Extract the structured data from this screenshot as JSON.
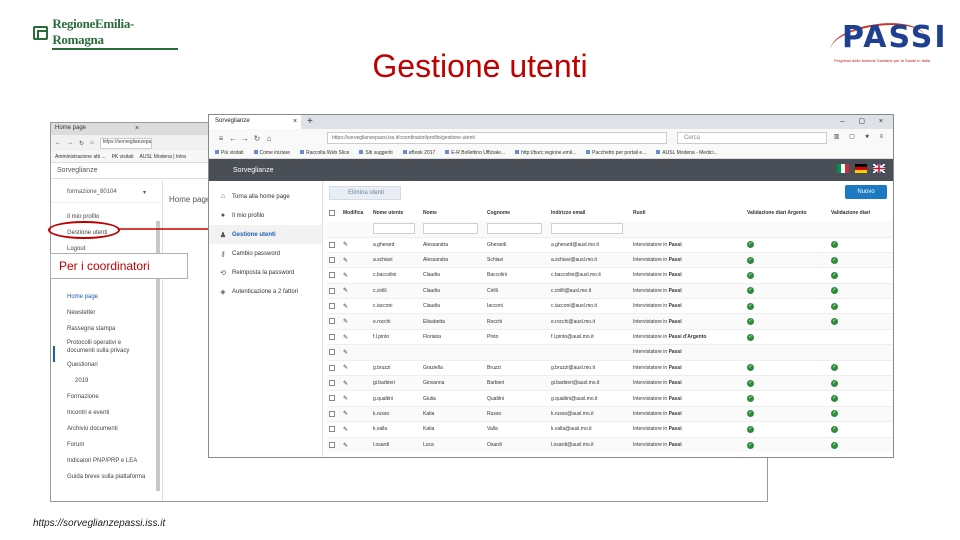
{
  "slide": {
    "title": "Gestione utenti",
    "logo_left": "RegioneEmilia-Romagna",
    "logo_right": "PASSI",
    "logo_right_sub": "Progressi delle Aziende Sanitarie per la Salute in Italia",
    "footer_url": "https://sorveglianzepassi.iss.it",
    "callout": "Per i coordinatori",
    "accent_color": "#c00000"
  },
  "back_window": {
    "tab_label": "Home page",
    "url": "https://sorveglianzepassi",
    "bookmarks": [
      "Amministrazione atti ...",
      "PK visitati",
      "AUSL Modena | Intra"
    ],
    "app_title": "Sorveglianze",
    "user": "formazione_80104",
    "menu": [
      "Il mio profilo",
      "Gestione utenti",
      "Logout"
    ],
    "nav": [
      "Home page",
      "Newsletter",
      "Rassegna stampa",
      "Protocolli operativi e documenti sulla privacy",
      "Questionari",
      "2019",
      "Formazione",
      "Incontri e eventi",
      "Archivio documenti",
      "Forum",
      "Indicatori PNP/PRP e LEA",
      "Guida breve sulla piattaforma"
    ],
    "main_title": "Home page"
  },
  "front_window": {
    "tab_label": "Sorveglianze",
    "url": "https://sorveglianzepassi.iss.it/coordinatori/profilo/gestione-utenti",
    "search_placeholder": "Cerca",
    "bookmarks": [
      "Più visitati",
      "Come iniziare",
      "Raccolta Web Slice",
      "Siti suggeriti",
      "eBook 2017",
      "E-R Bollettino Ufficiale...",
      "http://burc.regione.emil...",
      "Pacchetto per portali e...",
      "AUSL Modena - Medici..."
    ],
    "app_title": "Sorveglianze",
    "sidebar": [
      {
        "icon": "home-icon",
        "glyph": "⌂",
        "label": "Torna alla home page"
      },
      {
        "icon": "user-icon",
        "glyph": "●",
        "label": "Il mio profilo"
      },
      {
        "icon": "users-icon",
        "glyph": "♟",
        "label": "Gestione utenti"
      },
      {
        "icon": "key-icon",
        "glyph": "⚷",
        "label": "Cambio password"
      },
      {
        "icon": "reset-icon",
        "glyph": "⟲",
        "label": "Reimposta la password"
      },
      {
        "icon": "shield-icon",
        "glyph": "◈",
        "label": "Autenticazione a 2 fattori"
      }
    ],
    "delete_button": "Elimina utenti",
    "new_button": "Nuovo",
    "columns": [
      "Modifica",
      "Nome utente",
      "Nome",
      "Cognome",
      "Indirizzo email",
      "Ruoli",
      "Validazione diari Argento",
      "Validazione diari"
    ],
    "rows": [
      {
        "username": "a.gherard",
        "nome": "Alessandra",
        "cognome": "Gherardi",
        "email": "a.gherard@ausl.mo.it",
        "ruolo_a": "Intervistatore in",
        "ruolo_b": "Passi",
        "argento": true,
        "diari": true
      },
      {
        "username": "a.schiavi",
        "nome": "Alessandra",
        "cognome": "Schiavi",
        "email": "a.schiavi@ausl.mo.it",
        "ruolo_a": "Intervistatore in",
        "ruolo_b": "Passi",
        "argento": true,
        "diari": true
      },
      {
        "username": "c.baccolini",
        "nome": "Claudia",
        "cognome": "Baccolini",
        "email": "c.baccolini@ausl.mo.it",
        "ruolo_a": "Intervistatore in",
        "ruolo_b": "Passi",
        "argento": true,
        "diari": true
      },
      {
        "username": "c.cirilli",
        "nome": "Claudia",
        "cognome": "Cirilli",
        "email": "c.cirilli@ausl.mo.it",
        "ruolo_a": "Intervistatore in",
        "ruolo_b": "Passi",
        "argento": true,
        "diari": true
      },
      {
        "username": "c.iacconi",
        "nome": "Claudia",
        "cognome": "Iacconi",
        "email": "c.iacconi@ausl.mo.it",
        "ruolo_a": "Intervistatore in",
        "ruolo_b": "Passi",
        "argento": true,
        "diari": true
      },
      {
        "username": "e.rocchi",
        "nome": "Elisabetta",
        "cognome": "Rocchi",
        "email": "e.rocchi@ausl.mo.it",
        "ruolo_a": "Intervistatore in",
        "ruolo_b": "Passi",
        "argento": true,
        "diari": true
      },
      {
        "username": "f.l.pinto",
        "nome": "Floriana",
        "cognome": "Pinto",
        "email": "f.l.pinto@ausl.mo.it",
        "ruolo_a": "Intervistatore in",
        "ruolo_b": "Passi d'Argento",
        "argento": true,
        "diari": false
      },
      {
        "username": "",
        "nome": "",
        "cognome": "",
        "email": "",
        "ruolo_a": "Intervistatore in",
        "ruolo_b": "Passi",
        "argento": false,
        "diari": false
      },
      {
        "username": "g.bruzzi",
        "nome": "Graziella",
        "cognome": "Bruzzi",
        "email": "g.bruzzi@ausl.mo.it",
        "ruolo_a": "Intervistatore in",
        "ruolo_b": "Passi",
        "argento": true,
        "diari": true
      },
      {
        "username": "gi.barbieri",
        "nome": "Giovanna",
        "cognome": "Barbieri",
        "email": "gi.barbieri@ausl.mo.it",
        "ruolo_a": "Intervistatore in",
        "ruolo_b": "Passi",
        "argento": true,
        "diari": true
      },
      {
        "username": "g.qualtini",
        "nome": "Giulia",
        "cognome": "Qualtini",
        "email": "g.qualtini@ausl.mo.it",
        "ruolo_a": "Intervistatore in",
        "ruolo_b": "Passi",
        "argento": true,
        "diari": true
      },
      {
        "username": "k.russo",
        "nome": "Katia",
        "cognome": "Russo",
        "email": "k.russo@ausl.mo.it",
        "ruolo_a": "Intervistatore in",
        "ruolo_b": "Passi",
        "argento": true,
        "diari": true
      },
      {
        "username": "k.valla",
        "nome": "Katia",
        "cognome": "Valla",
        "email": "k.valla@ausl.mo.it",
        "ruolo_a": "Intervistatore in",
        "ruolo_b": "Passi",
        "argento": true,
        "diari": true
      },
      {
        "username": "l.osardi",
        "nome": "Luca",
        "cognome": "Osardi",
        "email": "l.osardi@ausl.mo.it",
        "ruolo_a": "Intervistatore in",
        "ruolo_b": "Passi",
        "argento": true,
        "diari": true
      }
    ]
  }
}
